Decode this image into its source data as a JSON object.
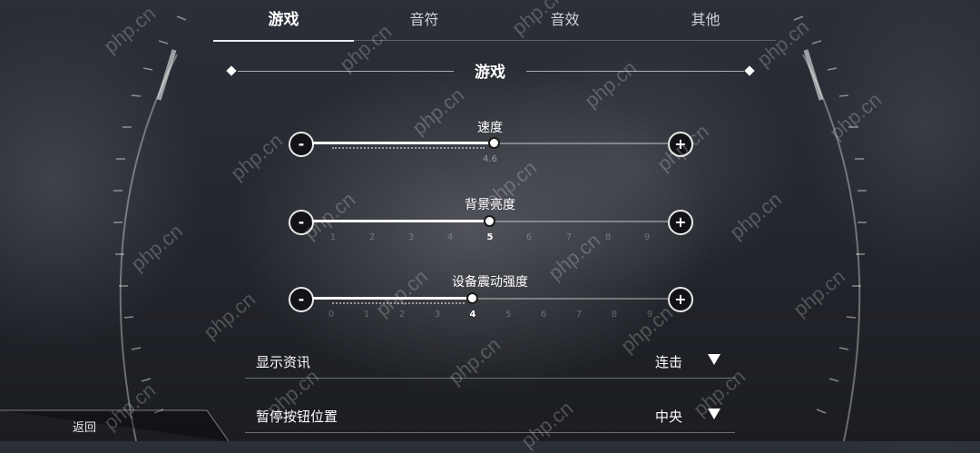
{
  "tabs": [
    {
      "label": "游戏",
      "active": true
    },
    {
      "label": "音符",
      "active": false
    },
    {
      "label": "音效",
      "active": false
    },
    {
      "label": "其他",
      "active": false
    }
  ],
  "section": {
    "title": "游戏"
  },
  "sliders": [
    {
      "label": "速度",
      "value": 4.6,
      "value_text": "4.6",
      "min_label": "-",
      "max_label": "+",
      "ticks": []
    },
    {
      "label": "背景亮度",
      "value": 5,
      "min_label": "-",
      "max_label": "+",
      "ticks": [
        "1",
        "2",
        "3",
        "4",
        "5",
        "6",
        "7",
        "8",
        "9"
      ]
    },
    {
      "label": "设备震动强度",
      "value": 4,
      "min_label": "-",
      "max_label": "+",
      "ticks": [
        "0",
        "1",
        "2",
        "3",
        "4",
        "5",
        "6",
        "7",
        "8",
        "9"
      ]
    }
  ],
  "options": [
    {
      "label": "显示资讯",
      "value": "连击",
      "icon": "dropdown-triangle-icon"
    },
    {
      "label": "暂停按钮位置",
      "value": "中央",
      "icon": "dropdown-triangle-icon"
    }
  ],
  "back": {
    "label": "返回"
  },
  "watermark": {
    "text": "php.cn"
  },
  "colors": {
    "accent": "#ffffff",
    "background": "#24272e",
    "button_fill": "#121317"
  }
}
